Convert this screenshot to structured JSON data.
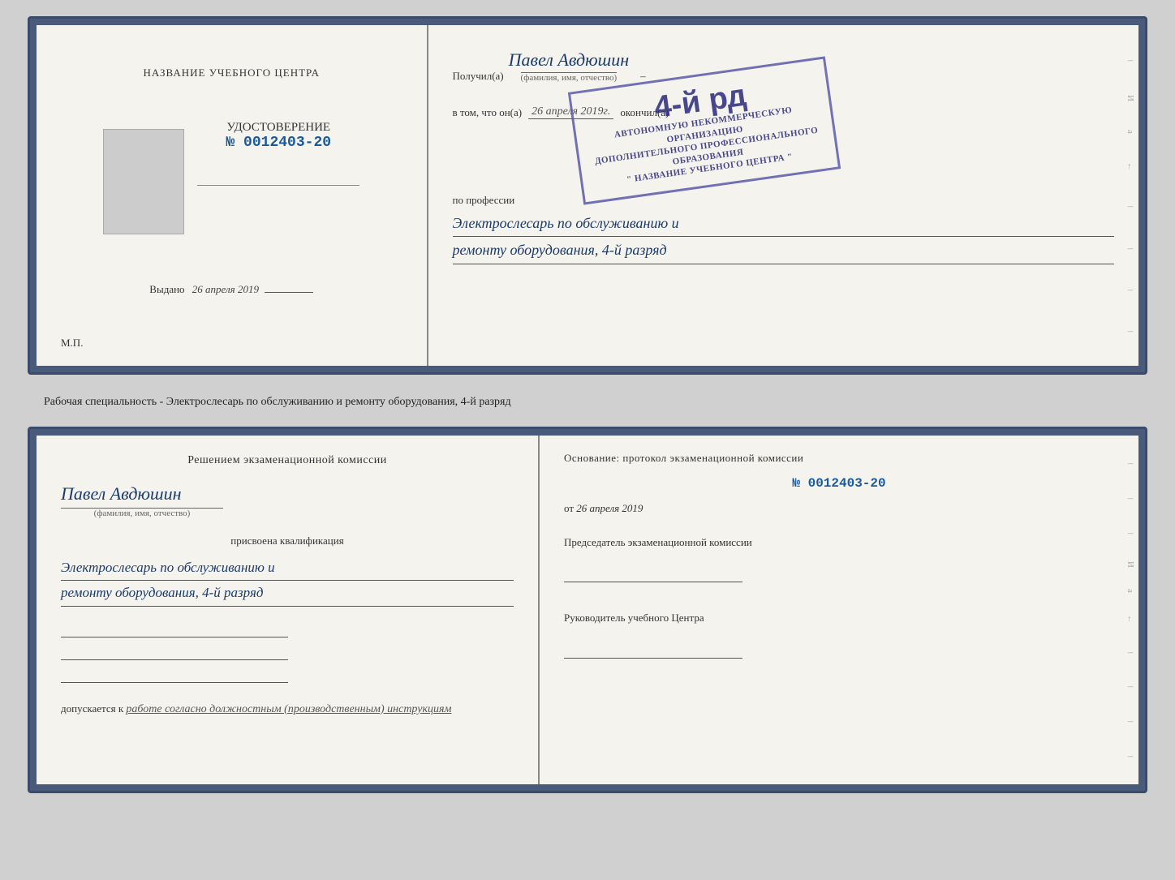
{
  "topLeft": {
    "centerTitle": "НАЗВАНИЕ УЧЕБНОГО ЦЕНТРА",
    "certLabel": "УДОСТОВЕРЕНИЕ",
    "certNum": "№ 0012403-20",
    "issuedLabel": "Выдано",
    "issuedDate": "26 апреля 2019",
    "mpLabel": "М.П."
  },
  "topRight": {
    "recipientPrefix": "Получил(а)",
    "recipientName": "Павел Авдюшин",
    "recipientSubLabel": "(фамилия, имя, отчество)",
    "vtomPrefix": "в том, что он(а)",
    "vtomDate": "26 апреля 2019г.",
    "vtomSuffix": "окончил(а)",
    "stampLine1": "4-й рд",
    "stampLine2": "АВТОНОМНУЮ НЕКОММЕРЧЕСКУЮ ОРГАНИЗАЦИЮ",
    "stampLine3": "ДОПОЛНИТЕЛЬНОГО ПРОФЕССИОНАЛЬНОГО ОБРАЗОВАНИЯ",
    "stampLine4": "\" НАЗВАНИЕ УЧЕБНОГО ЦЕНТРА \"",
    "professionLabel": "по профессии",
    "professionLine1": "Электрослесарь по обслуживанию и",
    "professionLine2": "ремонту оборудования, 4-й разряд"
  },
  "separatorText": "Рабочая специальность - Электрослесарь по обслуживанию и ремонту оборудования, 4-й разряд",
  "bottomLeft": {
    "commissionTitle": "Решением экзаменационной комиссии",
    "personName": "Павел Авдюшин",
    "personSubLabel": "(фамилия, имя, отчество)",
    "qualificationLabel": "присвоена квалификация",
    "qualificationLine1": "Электрослесарь по обслуживанию и",
    "qualificationLine2": "ремонту оборудования, 4-й разряд",
    "допускаетсяPrefix": "допускается к",
    "допускаетсяText": "работе согласно должностным (производственным) инструкциям"
  },
  "bottomRight": {
    "osnovaniePart1": "Основание: протокол экзаменационной комиссии",
    "protocolNum": "№ 0012403-20",
    "fromLabel": "от",
    "fromDate": "26 апреля 2019",
    "chairmanLabel": "Председатель экзаменационной комиссии",
    "headLabel": "Руководитель учебного Центра"
  },
  "sideMarks": {
    "marks": [
      "И",
      "а",
      "←",
      "–",
      "–",
      "–",
      "–"
    ]
  }
}
